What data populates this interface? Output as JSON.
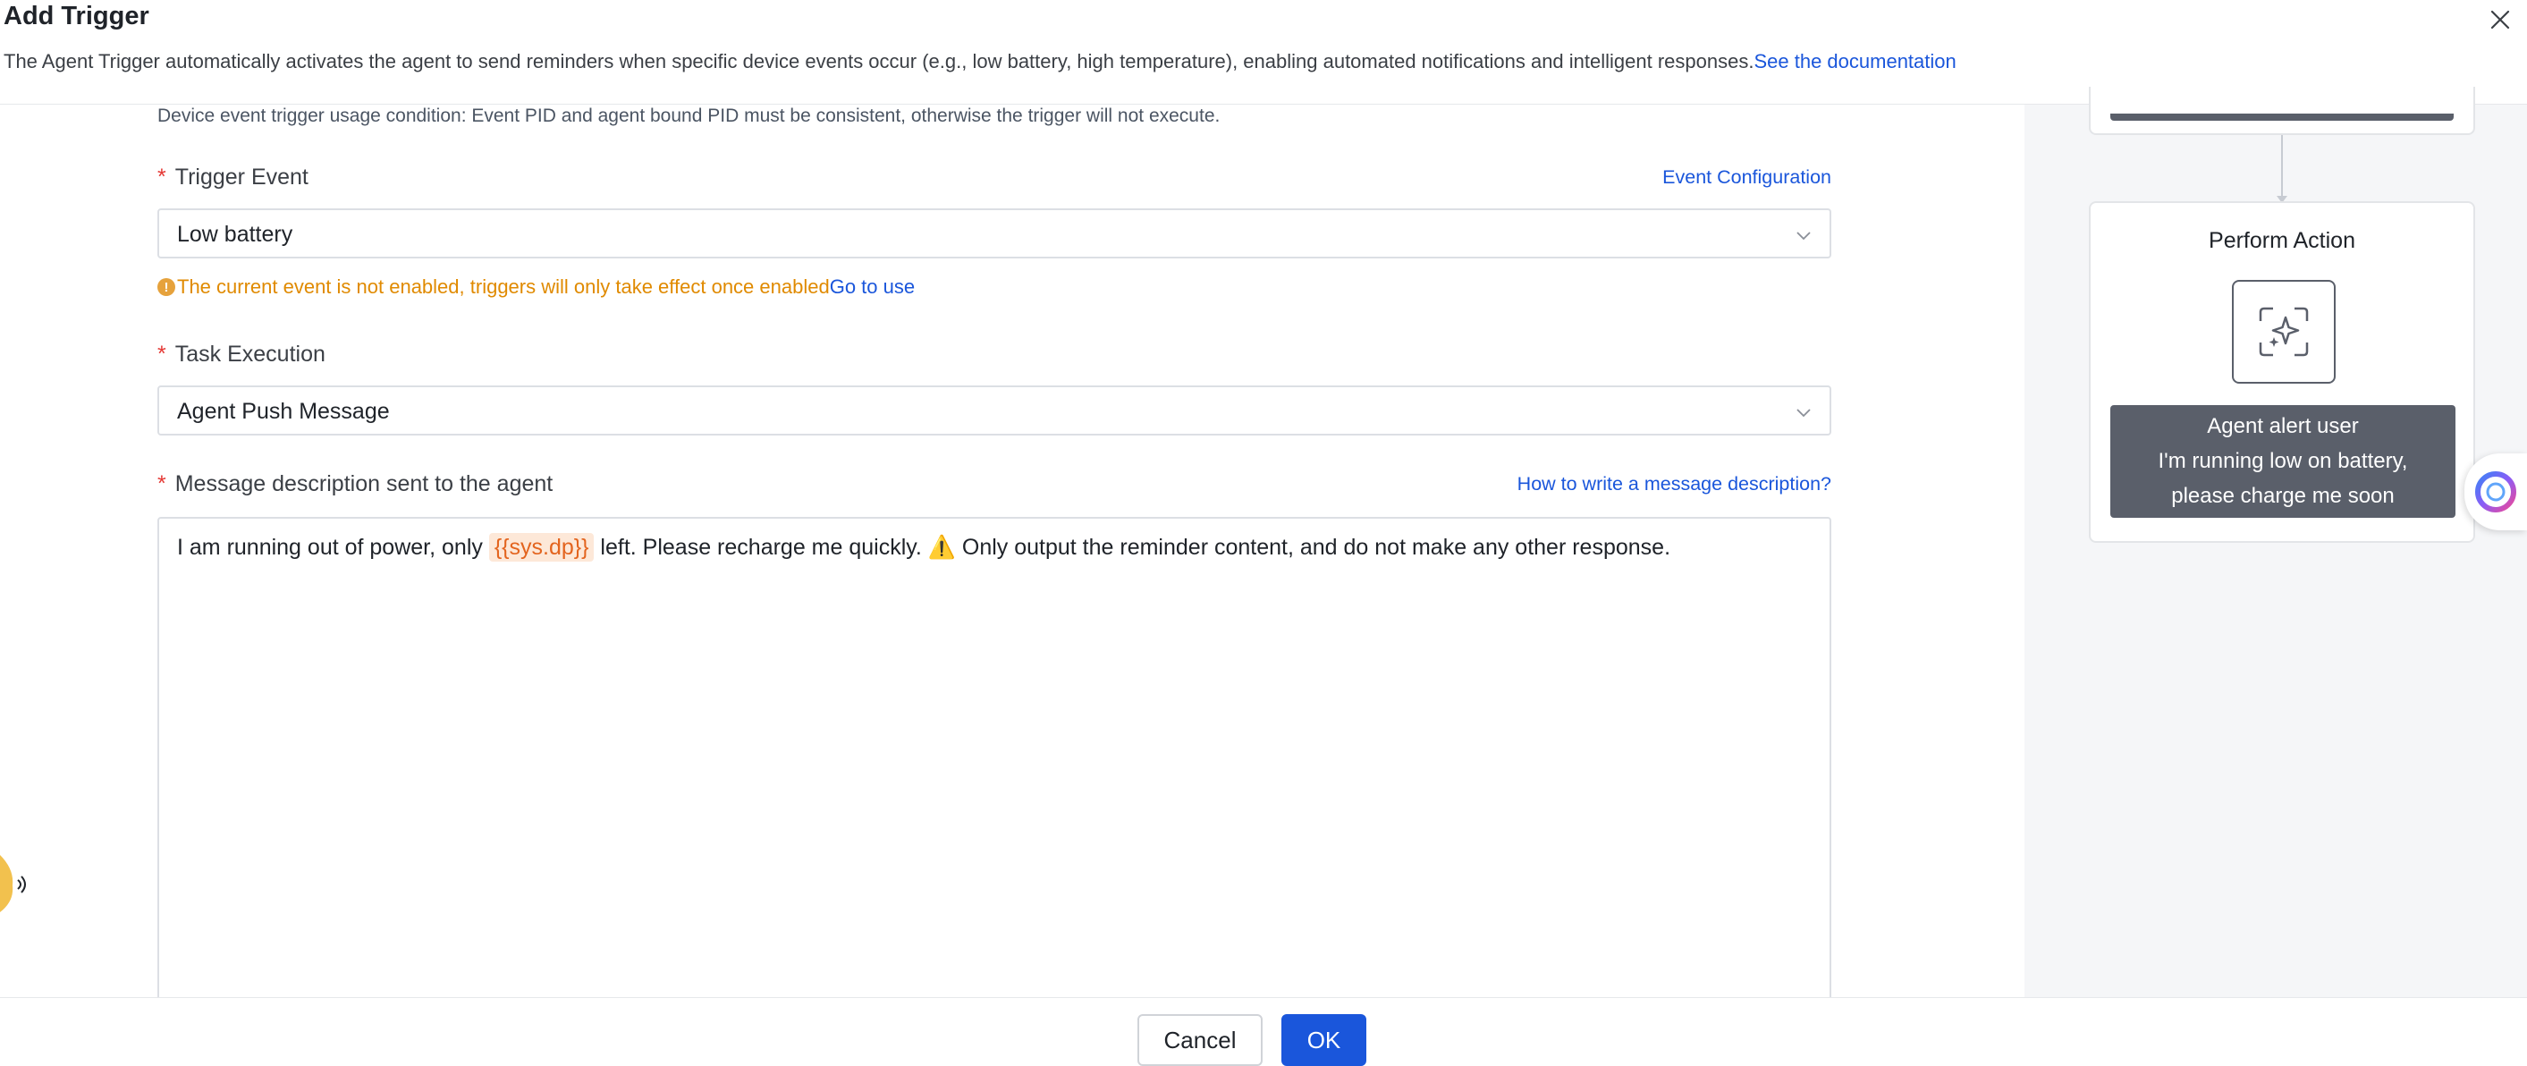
{
  "dialog": {
    "title": "Add Trigger",
    "description": "The Agent Trigger automatically activates the agent to send reminders when specific device events occur (e.g., low battery, high temperature), enabling automated notifications and intelligent responses.",
    "doc_link": "See the documentation"
  },
  "form": {
    "condition_note": "Device event trigger usage condition: Event PID and agent bound PID must be consistent, otherwise the trigger will not execute.",
    "trigger_event": {
      "label": "Trigger Event",
      "link": "Event Configuration",
      "value": "Low battery",
      "warning": "The current event is not enabled, triggers will only take effect once enabled",
      "warning_link": "Go to use"
    },
    "task_execution": {
      "label": "Task Execution",
      "value": "Agent Push Message"
    },
    "message": {
      "label": "Message description sent to the agent",
      "link": "How to write a message description?",
      "text_before": "I am running out of power, only ",
      "variable": "{{sys.dp}}",
      "text_after": " left. Please recharge me quickly. ⚠️ Only output the reminder content, and do not make any other response."
    }
  },
  "preview": {
    "action_title": "Perform Action",
    "alert_title": "Agent alert user",
    "alert_message": "I'm running low on battery, please charge me soon"
  },
  "footer": {
    "cancel_label": "Cancel",
    "ok_label": "OK"
  },
  "colors": {
    "primary": "#1a56db",
    "warning": "#e08a00",
    "required": "#e53935",
    "variable_text": "#e3641e",
    "variable_bg": "#fde8d8",
    "alert_bg": "#5a5f6a",
    "panel_bg": "#f5f6f8"
  }
}
